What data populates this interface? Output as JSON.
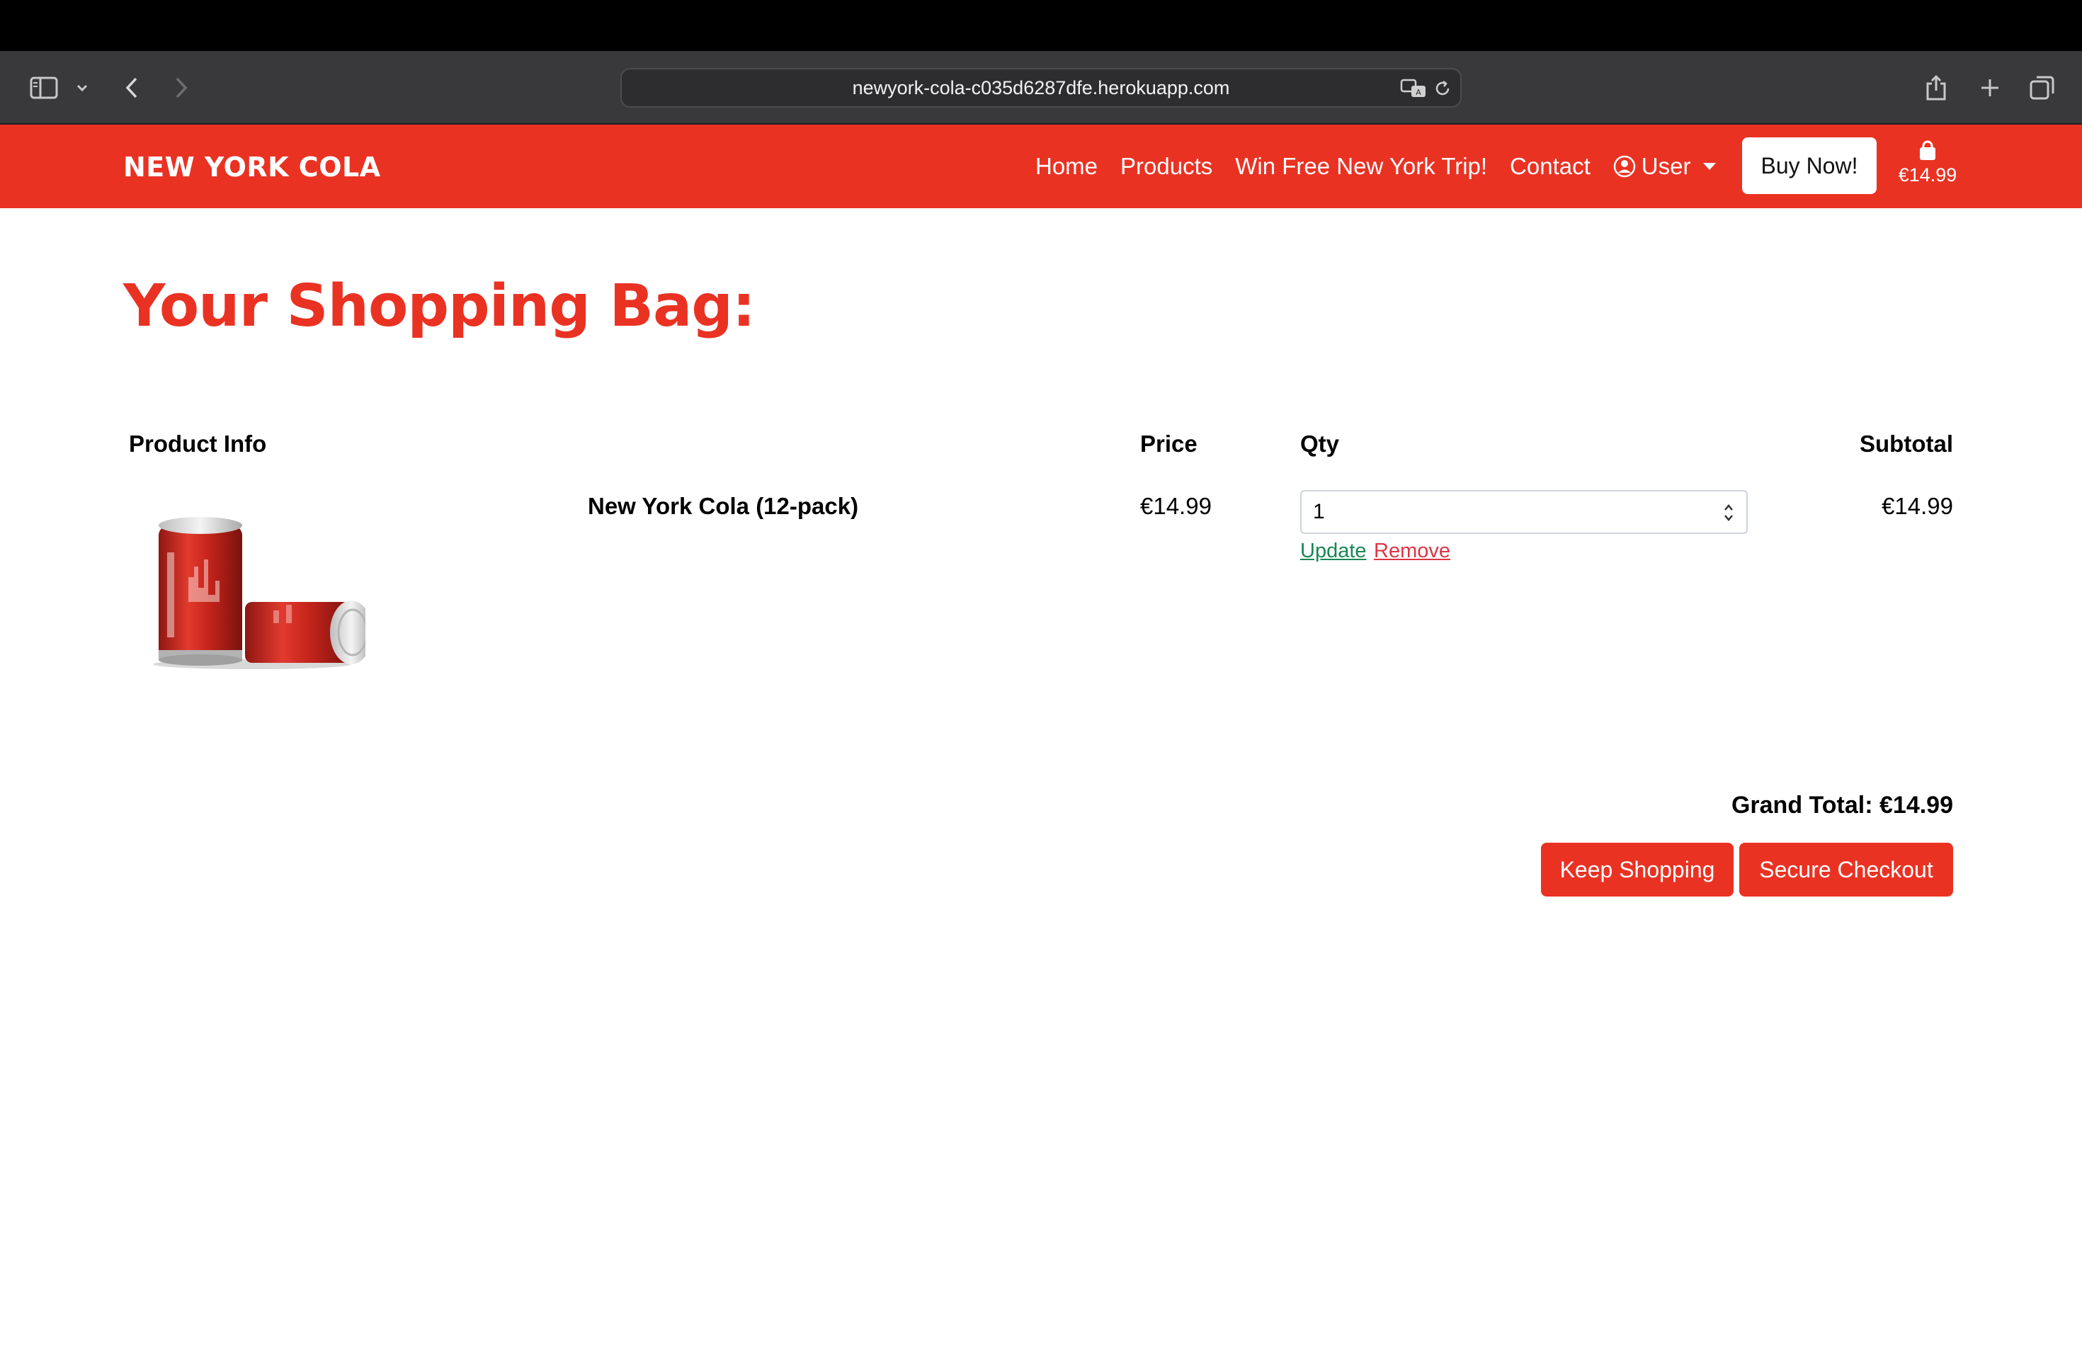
{
  "browser": {
    "url": "newyork-cola-c035d6287dfe.herokuapp.com",
    "icons": [
      "sidebar-icon",
      "chevron-down-icon",
      "back-icon",
      "forward-icon",
      "translate-icon",
      "reload-icon",
      "share-icon",
      "new-tab-icon",
      "tabs-overview-icon"
    ]
  },
  "navbar": {
    "brand": "NEW YORK COLA",
    "links": [
      "Home",
      "Products",
      "Win Free New York Trip!",
      "Contact"
    ],
    "user_label": "User",
    "buy_label": "Buy Now!",
    "bag_total": "€14.99"
  },
  "page": {
    "title": "Your Shopping Bag:"
  },
  "table": {
    "headers": {
      "product": "Product Info",
      "price": "Price",
      "qty": "Qty",
      "subtotal": "Subtotal"
    },
    "rows": [
      {
        "name": "New York Cola (12-pack)",
        "price": "€14.99",
        "qty": "1",
        "subtotal": "€14.99",
        "update_label": "Update",
        "remove_label": "Remove"
      }
    ]
  },
  "summary": {
    "grand_total": "Grand Total: €14.99",
    "keep_shopping": "Keep Shopping",
    "secure_checkout": "Secure Checkout"
  },
  "colors": {
    "brand_red": "#ea3223",
    "update_green": "#198754",
    "remove_red": "#dc3545"
  }
}
